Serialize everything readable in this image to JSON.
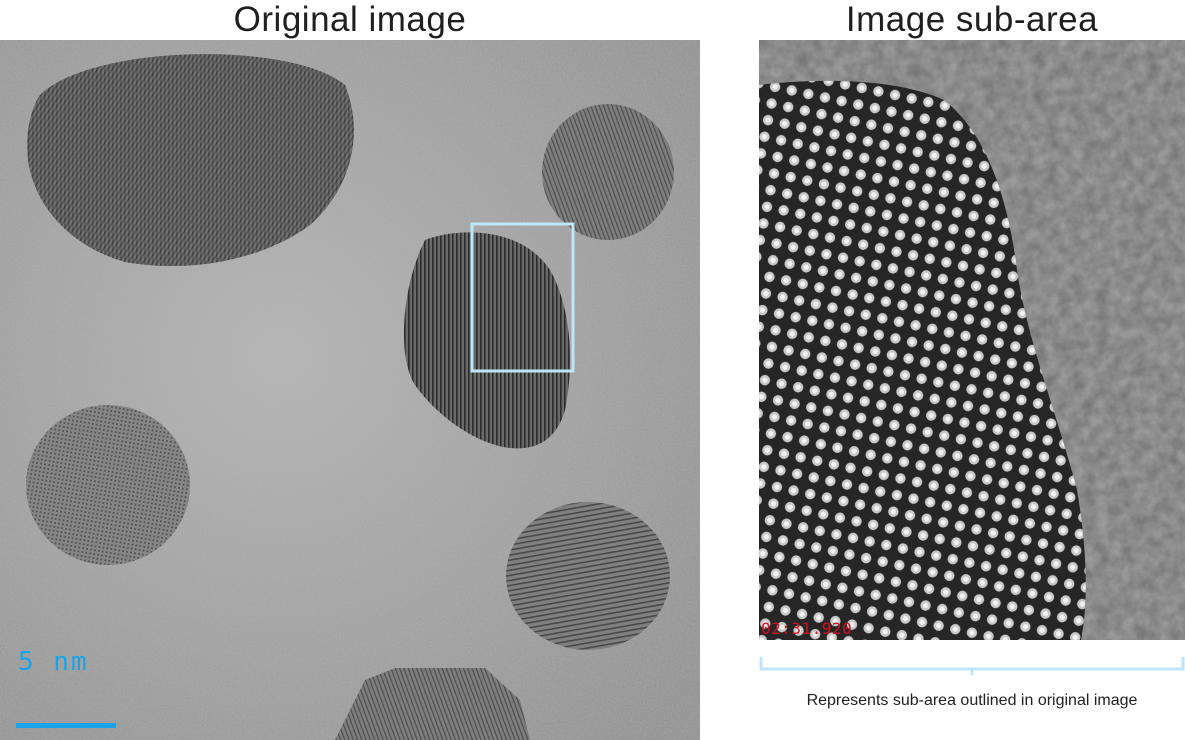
{
  "titles": {
    "left": "Original image",
    "right": "Image sub-area"
  },
  "original": {
    "scale_label": "5 nm",
    "accent_color": "#1aa3e8",
    "outline_color": "#bfe6f8"
  },
  "subarea": {
    "timestamp": "02:31.920",
    "caption": "Represents sub-area outlined in original image",
    "timestamp_color": "#d01020"
  }
}
